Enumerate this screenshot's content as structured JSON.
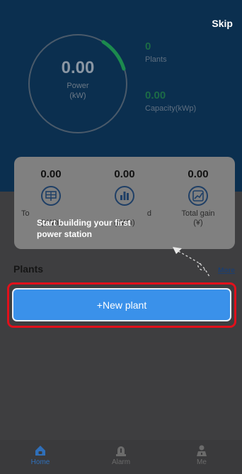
{
  "header": {
    "skip_label": "Skip"
  },
  "power": {
    "value": "0.00",
    "label": "Power",
    "unit": "(kW)"
  },
  "plants_stat": {
    "value": "0",
    "label": "Plants"
  },
  "capacity_stat": {
    "value": "0.00",
    "label": "Capacity(kWp)"
  },
  "summary": {
    "today_value": "0.00",
    "today_label": "To",
    "today_unit": "(kWh)",
    "total_value": "0.00",
    "total_label": "d",
    "total_unit": "(kWh)",
    "gain_value": "0.00",
    "gain_label": "Total gain",
    "gain_unit": "(¥)"
  },
  "tip": {
    "text": "Start building your first power station"
  },
  "plants_section": {
    "title": "Plants",
    "more_label": "More"
  },
  "new_plant": {
    "label": "+New plant"
  },
  "tabbar": {
    "items": [
      {
        "label": "Home",
        "icon": "home-icon",
        "color": "#2f6fb9"
      },
      {
        "label": "Alarm",
        "icon": "alarm-icon",
        "color": "#6b6b6b"
      },
      {
        "label": "Me",
        "icon": "person-icon",
        "color": "#6b6b6b"
      }
    ]
  },
  "colors": {
    "hero_bg": "#0b2f4f",
    "accent": "#3a91ea",
    "highlight_border": "#e2101b",
    "gauge_arc": "#1c8a4e"
  }
}
